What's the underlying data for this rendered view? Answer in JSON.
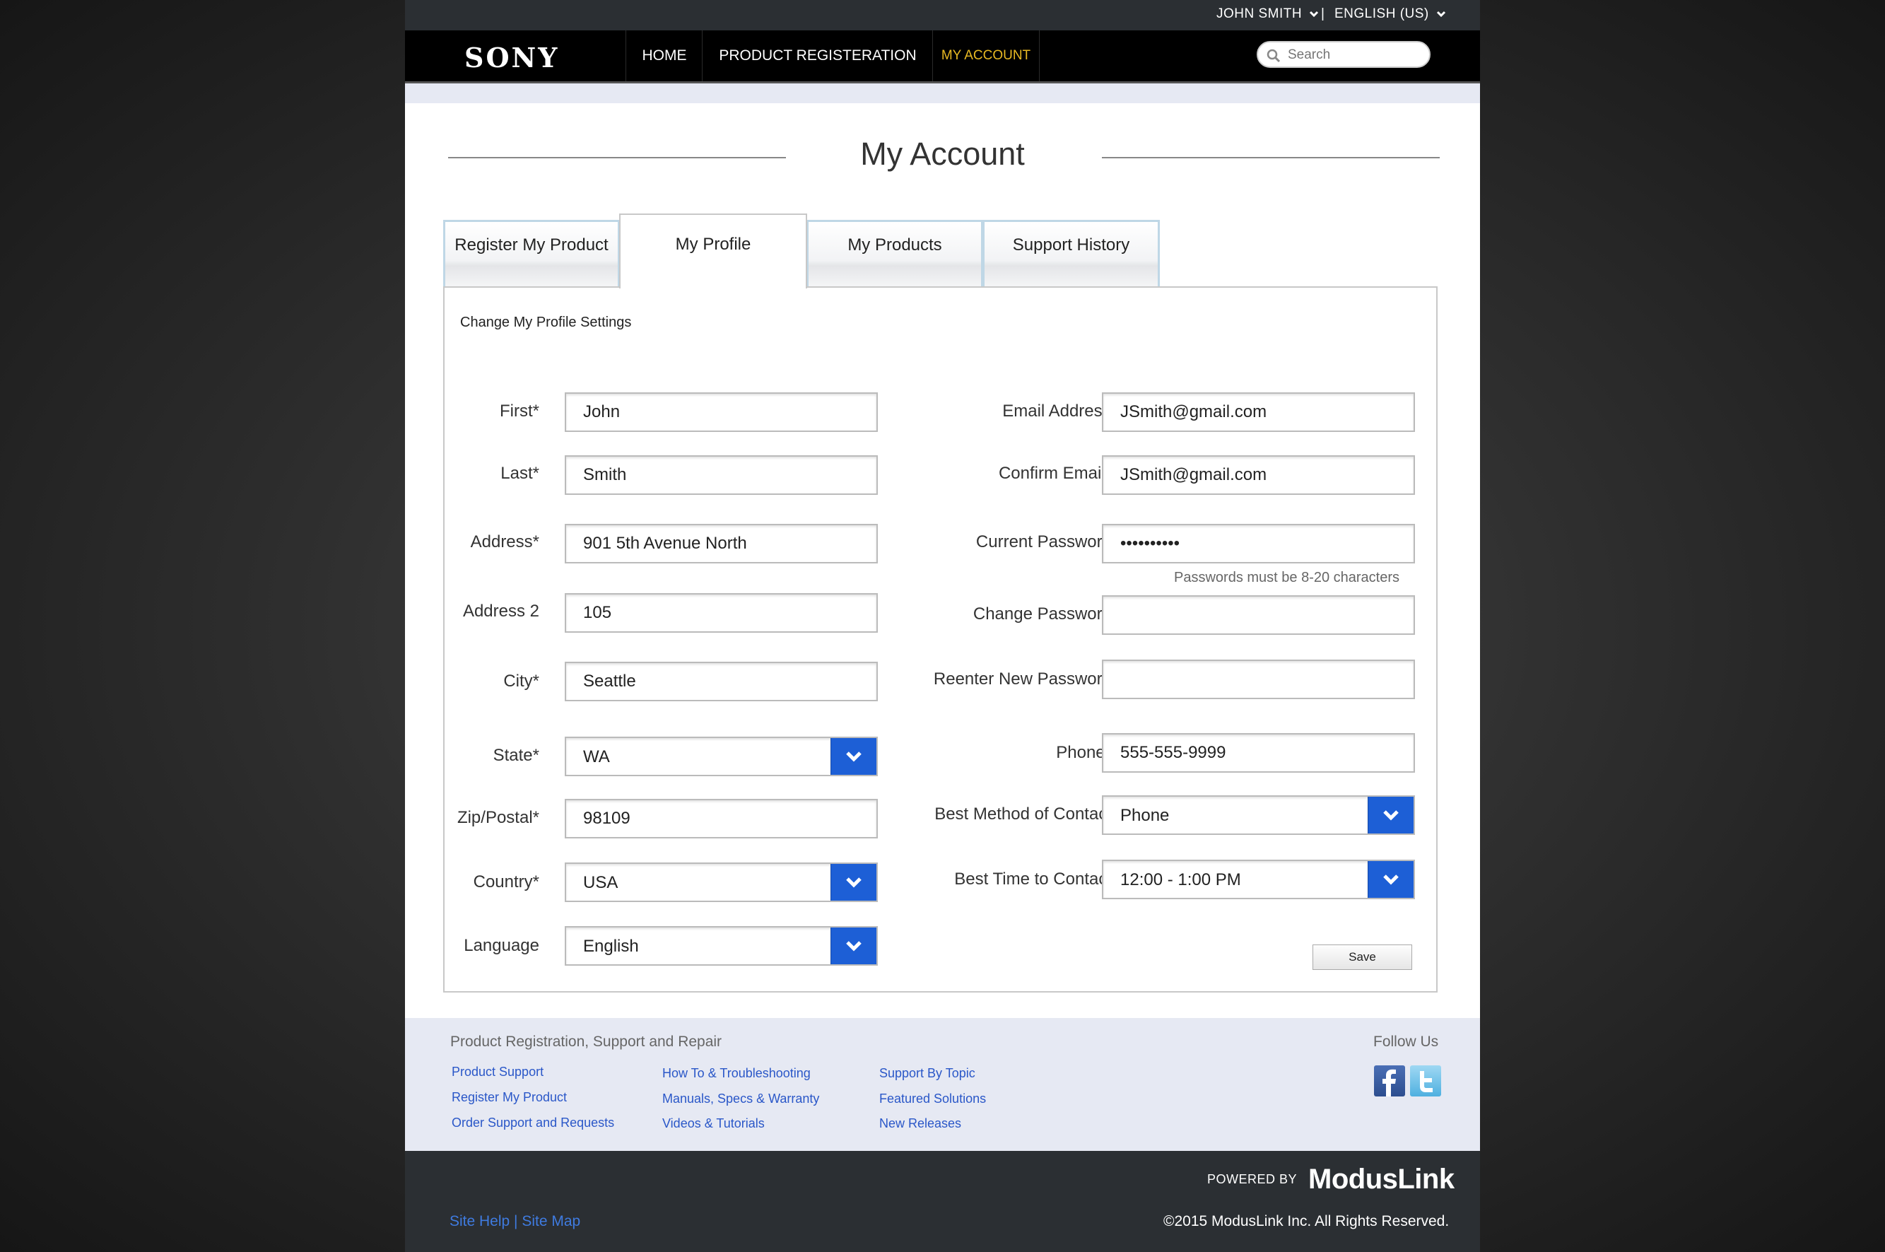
{
  "utility": {
    "user": "JOHN SMITH",
    "separator": "|",
    "language": "ENGLISH (US)"
  },
  "nav": {
    "logo": "SONY",
    "home": "HOME",
    "product_registration": "PRODUCT REGISTERATION",
    "my_account": "MY ACCOUNT",
    "search_placeholder": "Search"
  },
  "page": {
    "title": "My Account"
  },
  "tabs": [
    {
      "label": "Register My Product",
      "active": false
    },
    {
      "label": "My Profile",
      "active": true
    },
    {
      "label": "My Products",
      "active": false
    },
    {
      "label": "Support History",
      "active": false
    }
  ],
  "form": {
    "heading": "Change My Profile Settings",
    "first": {
      "label": "First*",
      "value": "John"
    },
    "last": {
      "label": "Last*",
      "value": "Smith"
    },
    "address": {
      "label": "Address*",
      "value": "901 5th Avenue North"
    },
    "address2": {
      "label": "Address 2",
      "value": "105"
    },
    "city": {
      "label": "City*",
      "value": "Seattle"
    },
    "state": {
      "label": "State*",
      "value": "WA"
    },
    "zip": {
      "label": "Zip/Postal*",
      "value": "98109"
    },
    "country": {
      "label": "Country*",
      "value": "USA"
    },
    "language": {
      "label": "Language",
      "value": "English"
    },
    "email": {
      "label": "Email Address*",
      "value": "JSmith@gmail.com"
    },
    "confirm_email": {
      "label": "Confirm Email*",
      "value": "JSmith@gmail.com"
    },
    "current_password": {
      "label": "Current Password",
      "value": "••••••••••"
    },
    "password_hint": "Passwords must be 8-20 characters",
    "change_password": {
      "label": "Change Password",
      "value": ""
    },
    "reenter_password": {
      "label": "Reenter New Password",
      "value": ""
    },
    "phone": {
      "label": "Phone*",
      "value": "555-555-9999"
    },
    "best_method": {
      "label": "Best Method of Contact",
      "value": "Phone"
    },
    "best_time": {
      "label": "Best Time to Contact",
      "value": "12:00 - 1:00 PM"
    },
    "save_label": "Save"
  },
  "footer": {
    "title": "Product Registration, Support and Repair",
    "follow_us": "Follow Us",
    "col1": [
      "Product Support",
      "Register My Product",
      "Order Support and Requests"
    ],
    "col2": [
      "How To & Troubleshooting",
      "Manuals, Specs & Warranty",
      "Videos & Tutorials"
    ],
    "col3": [
      "Support By Topic",
      "Featured Solutions",
      "New Releases"
    ],
    "powered_by": "POWERED BY",
    "brand": "ModusLink",
    "site_help": "Site Help | Site Map",
    "copyright": "©2015 ModusLink Inc. All Rights Reserved."
  },
  "colors": {
    "accent_blue": "#1d5fd6",
    "active_nav": "#e8b923",
    "link": "#2a57c8"
  },
  "icons": [
    "chevron-down-icon",
    "search-icon",
    "facebook-icon",
    "twitter-icon"
  ]
}
